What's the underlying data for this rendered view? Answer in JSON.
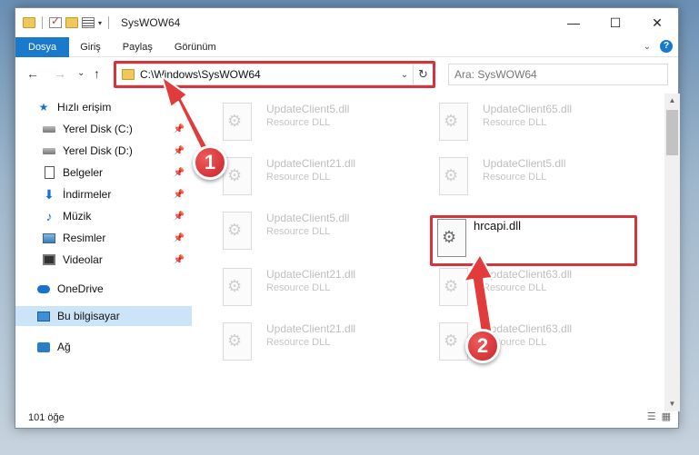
{
  "window": {
    "title": "SysWOW64",
    "minimize": "—",
    "maximize": "☐",
    "close": "✕"
  },
  "ribbon": {
    "tabs": [
      "Dosya",
      "Giriş",
      "Paylaş",
      "Görünüm"
    ],
    "help": "?"
  },
  "nav": {
    "back": "←",
    "forward": "→",
    "recent": "⌄",
    "up": "↑",
    "address": "C:\\Windows\\SysWOW64",
    "refresh": "↻",
    "search_placeholder": "Ara: SysWOW64"
  },
  "sidebar": {
    "items": [
      {
        "label": "Hızlı erişim",
        "icon": "star-icon"
      },
      {
        "label": "Yerel Disk (C:)",
        "icon": "drive-icon"
      },
      {
        "label": "Yerel Disk (D:)",
        "icon": "drive-icon"
      },
      {
        "label": "Belgeler",
        "icon": "document-icon"
      },
      {
        "label": "İndirmeler",
        "icon": "download-icon"
      },
      {
        "label": "Müzik",
        "icon": "music-icon"
      },
      {
        "label": "Resimler",
        "icon": "pictures-icon"
      },
      {
        "label": "Videolar",
        "icon": "video-icon"
      },
      {
        "label": "OneDrive",
        "icon": "cloud-icon"
      },
      {
        "label": "Bu bilgisayar",
        "icon": "computer-icon"
      },
      {
        "label": "Ağ",
        "icon": "network-icon"
      }
    ]
  },
  "files": [
    {
      "name": "UpdateClient5.dll",
      "type": "Resource DLL"
    },
    {
      "name": "UpdateClient65.dll",
      "type": "Resource DLL"
    },
    {
      "name": "UpdateClient21.dll",
      "type": "Resource DLL"
    },
    {
      "name": "UpdateClient5.dll",
      "type": "Resource DLL"
    },
    {
      "name": "UpdateClient5.dll",
      "type": "Resource DLL"
    },
    {
      "name": "UpdateClient21.dll",
      "type": "Resource DLL"
    },
    {
      "name": "UpdateClient63.dll",
      "type": "Resource DLL"
    },
    {
      "name": "UpdateClient21.dll",
      "type": "Resource DLL"
    },
    {
      "name": "UpdateClient63.dll",
      "type": "Resource DLL"
    }
  ],
  "highlighted_file": {
    "name": "hrcapi.dll"
  },
  "status": {
    "item_count": "101 öğe"
  },
  "annotations": {
    "step1": "1",
    "step2": "2"
  },
  "colors": {
    "accent": "#1979ca",
    "highlight": "#d5343b",
    "selection": "#cce4f7"
  }
}
